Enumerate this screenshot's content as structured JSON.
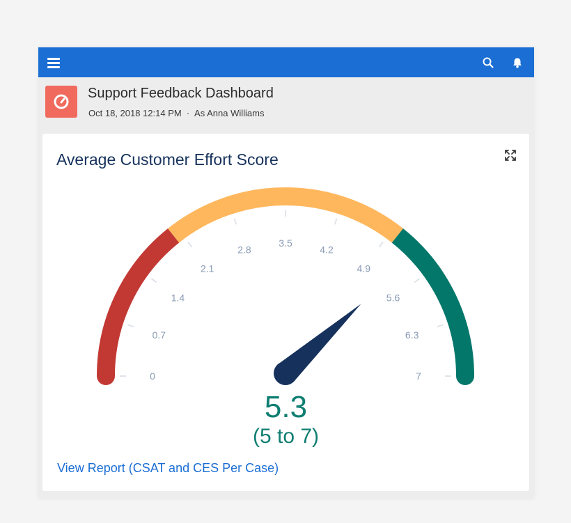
{
  "header": {
    "title": "Support Feedback Dashboard",
    "date": "Oct 18, 2018 12:14 PM",
    "separator": "·",
    "viewer": "As Anna Williams"
  },
  "card": {
    "title": "Average Customer Effort Score",
    "link_label": "View Report (CSAT and CES Per Case)"
  },
  "gauge": {
    "value_label": "5.3",
    "range_label": "(5 to 7)",
    "min": 0,
    "max": 7,
    "value": 5.3,
    "tick_labels": [
      "0",
      "0.7",
      "1.4",
      "2.1",
      "2.8",
      "3.5",
      "4.2",
      "4.9",
      "5.6",
      "6.3",
      "7"
    ],
    "segments": [
      {
        "from": 0,
        "to": 2,
        "color": "#c23934"
      },
      {
        "from": 2,
        "to": 5,
        "color": "#ffb75d"
      },
      {
        "from": 5,
        "to": 7,
        "color": "#04776b"
      }
    ]
  },
  "colors": {
    "brand": "#1b6ed4",
    "dashboard_icon_bg": "#f06a5e",
    "needle": "#16325c",
    "value_text": "#0f7e72",
    "tick_label": "#8a9bb5"
  },
  "icons": {
    "menu": "hamburger-icon",
    "search": "search-icon",
    "notifications": "bell-icon",
    "dashboard": "gauge-icon",
    "expand": "expand-icon"
  }
}
